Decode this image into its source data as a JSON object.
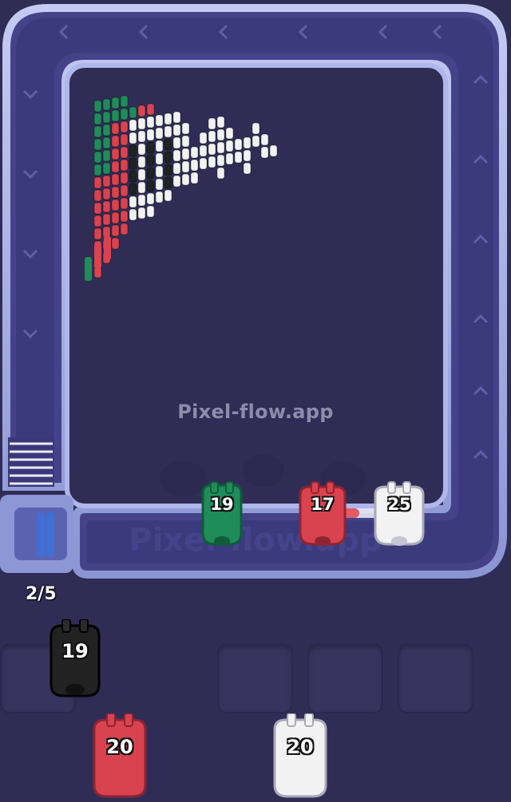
{
  "game": {
    "watermark": "Pixel-flow.app",
    "conveyor_watermark": "Pixel-flow.app",
    "capacity_counter": "2/5",
    "colors": {
      "background": "#2f2d55",
      "track": "#9ea8e0",
      "green": "#1f8c5a",
      "red": "#d9434f",
      "white": "#f2f2f2",
      "black": "#222222"
    }
  },
  "conveyor_pigs": [
    {
      "color": "green",
      "count": "19"
    },
    {
      "color": "red",
      "count": "17"
    },
    {
      "color": "white",
      "count": "25"
    }
  ],
  "queue_pigs": [
    {
      "color": "black",
      "count": "19"
    },
    {
      "color": "red",
      "count": "20"
    },
    {
      "color": "white",
      "count": "20"
    }
  ],
  "slots": [
    "empty",
    "empty",
    "empty",
    "empty",
    "empty"
  ]
}
